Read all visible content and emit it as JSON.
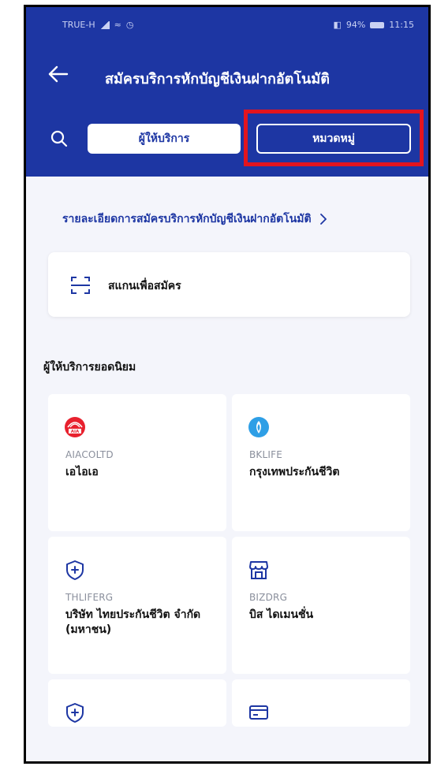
{
  "status_bar": {
    "carrier": "TRUE-H",
    "battery": "94%",
    "time": "11:15"
  },
  "header": {
    "title": "สมัครบริการหักบัญชีเงินฝากอัตโนมัติ"
  },
  "tabs": [
    {
      "label": "ผู้ให้บริการ"
    },
    {
      "label": "หมวดหมู่"
    }
  ],
  "details_link": "รายละเอียดการสมัครบริการหักบัญชีเงินฝากอัตโนมัติ",
  "scan": {
    "label": "สแกนเพื่อสมัคร"
  },
  "popular": {
    "title": "ผู้ให้บริการยอดนิยม",
    "providers": [
      {
        "code": "AIACOLTD",
        "name": "เอไอเอ",
        "icon": "aia-logo-icon"
      },
      {
        "code": "BKLIFE",
        "name": "กรุงเทพประกันชีวิต",
        "icon": "bklife-logo-icon"
      },
      {
        "code": "THLIFERG",
        "name": "บริษัท ไทยประกันชีวิต จำกัด (มหาชน)",
        "icon": "shield-plus-icon"
      },
      {
        "code": "BIZDRG",
        "name": "บิส ไดเมนชั่น",
        "icon": "store-icon"
      },
      {
        "code": "",
        "name": "",
        "icon": "shield-plus-icon"
      },
      {
        "code": "",
        "name": "",
        "icon": "card-icon"
      }
    ]
  },
  "colors": {
    "brand": "#1d36a3",
    "highlight": "#e3141e",
    "background": "#f4f5fb"
  }
}
